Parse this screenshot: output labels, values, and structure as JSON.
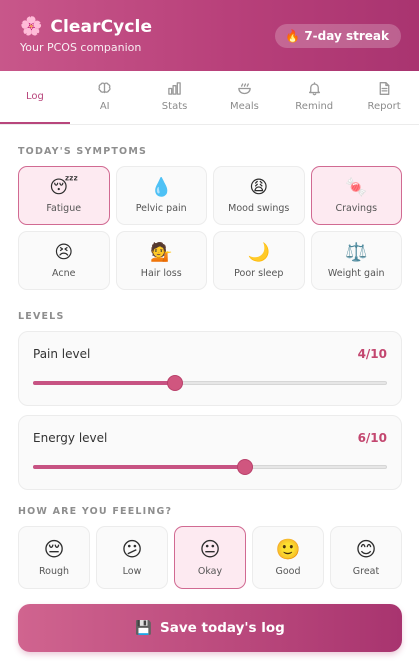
{
  "app": {
    "title": "ClearCycle",
    "subtitle": "Your PCOS companion",
    "logo_icon": "🌸",
    "streak_icon": "🔥",
    "streak_label": "7-day streak"
  },
  "tabs": [
    {
      "label": "Log",
      "icon": "none",
      "active": true
    },
    {
      "label": "AI",
      "icon": "brain-icon",
      "active": false
    },
    {
      "label": "Stats",
      "icon": "bar-chart-icon",
      "active": false
    },
    {
      "label": "Meals",
      "icon": "bowl-icon",
      "active": false
    },
    {
      "label": "Remind",
      "icon": "bell-icon",
      "active": false
    },
    {
      "label": "Report",
      "icon": "document-icon",
      "active": false
    }
  ],
  "symptoms": {
    "heading": "TODAY'S SYMPTOMS",
    "items": [
      {
        "label": "Fatigue",
        "emoji": "😴",
        "selected": true
      },
      {
        "label": "Pelvic pain",
        "emoji": "💧",
        "selected": false
      },
      {
        "label": "Mood swings",
        "emoji": "😩",
        "selected": false
      },
      {
        "label": "Cravings",
        "emoji": "🍬",
        "selected": true
      },
      {
        "label": "Acne",
        "emoji": "😣",
        "selected": false
      },
      {
        "label": "Hair loss",
        "emoji": "💁",
        "selected": false
      },
      {
        "label": "Poor sleep",
        "emoji": "🌙",
        "selected": false
      },
      {
        "label": "Weight gain",
        "emoji": "⚖️",
        "selected": false
      }
    ]
  },
  "levels": {
    "heading": "LEVELS",
    "pain": {
      "label": "Pain level",
      "display": "4/10",
      "value": 4,
      "max": 10
    },
    "energy": {
      "label": "Energy level",
      "display": "6/10",
      "value": 6,
      "max": 10
    }
  },
  "mood": {
    "heading": "HOW ARE YOU FEELING?",
    "items": [
      {
        "label": "Rough",
        "emoji": "😔",
        "selected": false
      },
      {
        "label": "Low",
        "emoji": "😕",
        "selected": false
      },
      {
        "label": "Okay",
        "emoji": "😐",
        "selected": true
      },
      {
        "label": "Good",
        "emoji": "🙂",
        "selected": false
      },
      {
        "label": "Great",
        "emoji": "😊",
        "selected": false
      }
    ]
  },
  "save": {
    "icon": "💾",
    "label": "Save today's log"
  },
  "colors": {
    "accent": "#b8467c",
    "selected_bg": "#fdeaf1",
    "value_text": "#c3466f"
  }
}
